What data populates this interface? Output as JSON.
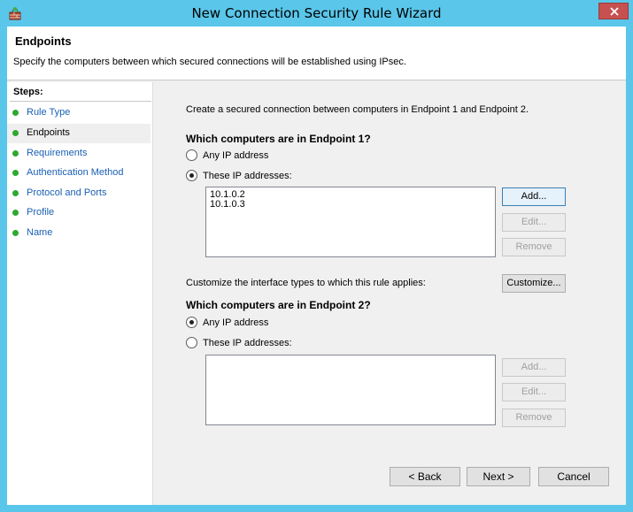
{
  "window": {
    "title": "New Connection Security Rule Wizard",
    "accent_color": "#5ac6ea",
    "close_color": "#c75050",
    "icon": "firewall-icon"
  },
  "header": {
    "title": "Endpoints",
    "description": "Specify the computers between which secured connections will be established using IPsec."
  },
  "steps": {
    "title": "Steps:",
    "items": [
      {
        "label": "Rule Type",
        "active": false
      },
      {
        "label": "Endpoints",
        "active": true
      },
      {
        "label": "Requirements",
        "active": false
      },
      {
        "label": "Authentication Method",
        "active": false
      },
      {
        "label": "Protocol and Ports",
        "active": false
      },
      {
        "label": "Profile",
        "active": false
      },
      {
        "label": "Name",
        "active": false
      }
    ]
  },
  "main": {
    "intro": "Create a secured connection between computers in Endpoint 1 and Endpoint 2.",
    "endpoint1": {
      "heading": "Which computers are in Endpoint 1?",
      "option_any": "Any IP address",
      "option_these": "These IP addresses:",
      "selected": "these",
      "addresses": [
        "10.1.0.2",
        "10.1.0.3"
      ],
      "add_label": "Add...",
      "edit_label": "Edit...",
      "remove_label": "Remove"
    },
    "customize_text": "Customize the interface types to which this rule applies:",
    "customize_label": "Customize...",
    "endpoint2": {
      "heading": "Which computers are in Endpoint 2?",
      "option_any": "Any IP address",
      "option_these": "These IP addresses:",
      "selected": "any",
      "addresses": [],
      "add_label": "Add...",
      "edit_label": "Edit...",
      "remove_label": "Remove"
    }
  },
  "footer": {
    "back_label": "< Back",
    "next_label": "Next >",
    "cancel_label": "Cancel"
  }
}
